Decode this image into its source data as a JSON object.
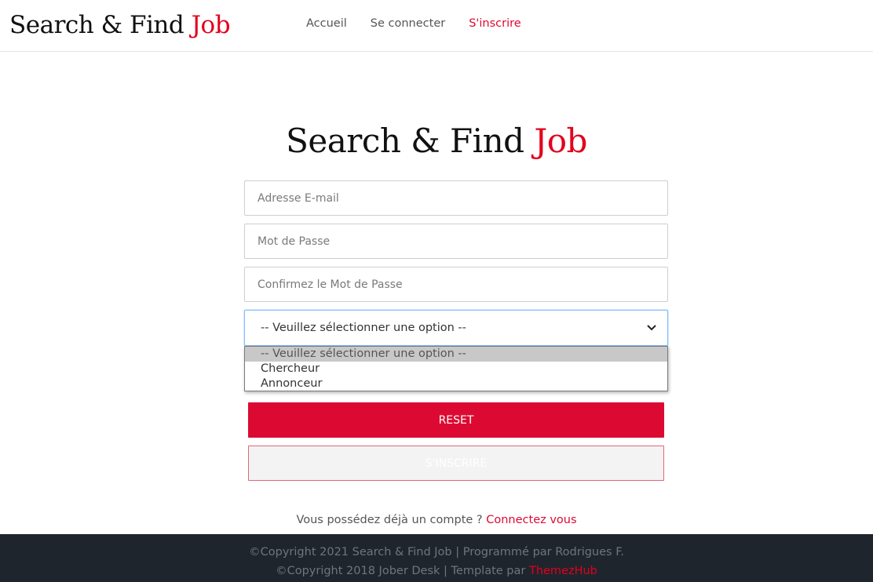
{
  "header": {
    "logo_main": "Search & Find",
    "logo_accent": "Job",
    "nav": [
      {
        "label": "Accueil"
      },
      {
        "label": "Se connecter"
      },
      {
        "label": "S'inscrire"
      }
    ]
  },
  "hero": {
    "title_main": "Search & Find",
    "title_accent": "Job"
  },
  "form": {
    "email_placeholder": "Adresse E-mail",
    "password_placeholder": "Mot de Passe",
    "confirm_placeholder": "Confirmez le Mot de Passe",
    "select_value": "-- Veuillez sélectionner une option --",
    "options": [
      "-- Veuillez sélectionner une option --",
      "Chercheur",
      "Annonceur"
    ],
    "reset_label": "RESET",
    "signup_label": "S'INSCRIRE"
  },
  "login_prompt": {
    "text": "Vous possédez déjà un compte ? ",
    "link": "Connectez vous"
  },
  "footer": {
    "line1": "©Copyright 2021 Search & Find Job | Programmé par Rodrigues F.",
    "line2_text": "©Copyright 2018 Jober Desk | Template par ",
    "line2_link": "ThemezHub"
  },
  "colors": {
    "accent": "#dc0a32",
    "footer_bg": "#1f252d"
  }
}
